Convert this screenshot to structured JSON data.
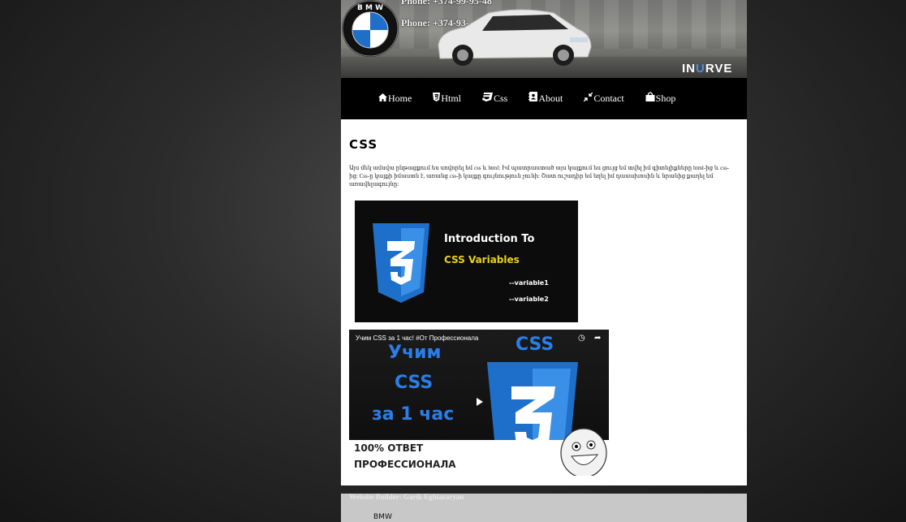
{
  "header": {
    "phone_1": "Phone: +374-99-95-48",
    "phone_2": "Phone: +374-93-",
    "brand_prefix": "IN",
    "brand_u": "U",
    "brand_suffix": "RVE"
  },
  "nav": {
    "items": [
      {
        "label": "Home",
        "icon": "home-icon"
      },
      {
        "label": "Html",
        "icon": "html5-icon"
      },
      {
        "label": "Css",
        "icon": "css3-icon"
      },
      {
        "label": "About",
        "icon": "address-book-icon"
      },
      {
        "label": "Contact",
        "icon": "compress-icon"
      },
      {
        "label": "Shop",
        "icon": "shopping-bag-icon"
      }
    ]
  },
  "content": {
    "title": "CSS",
    "paragraph": "Այս մեկ ամսվա ընթացքում ես սովորել եմ css և html: Իմ պատրաստած այս կայքում ես ցույց եմ տվել իմ գիտելիքները html-ից և css-ից: Css-ը կայքի իմաստն է, առանց css-ի կայքը գույնություն չունի: Շատ ուշադիր եմ եղել իմ դասախոսին և նրանից քաղել եմ առավելագույնը:",
    "image": {
      "line1": "Introduction To",
      "line2": "CSS Variables",
      "var1": "--variable1",
      "var2": "--variable2"
    },
    "video": {
      "title": "Учим CSS за 1 час! #От Профессионала",
      "big1": "Учим",
      "big2": "CSS",
      "big3": "за 1 час",
      "css_label": "CSS",
      "band1": "100% ОТВЕТ",
      "band2": "ПРОФЕССИОНАЛА"
    }
  },
  "footer": {
    "builder": "Website Builder: Garik Eghiazaryan",
    "brand": "BMW"
  },
  "colors": {
    "nav_bg": "#000000",
    "css_blue": "#2a7ee8",
    "footer_bg": "#c8c8c8"
  }
}
